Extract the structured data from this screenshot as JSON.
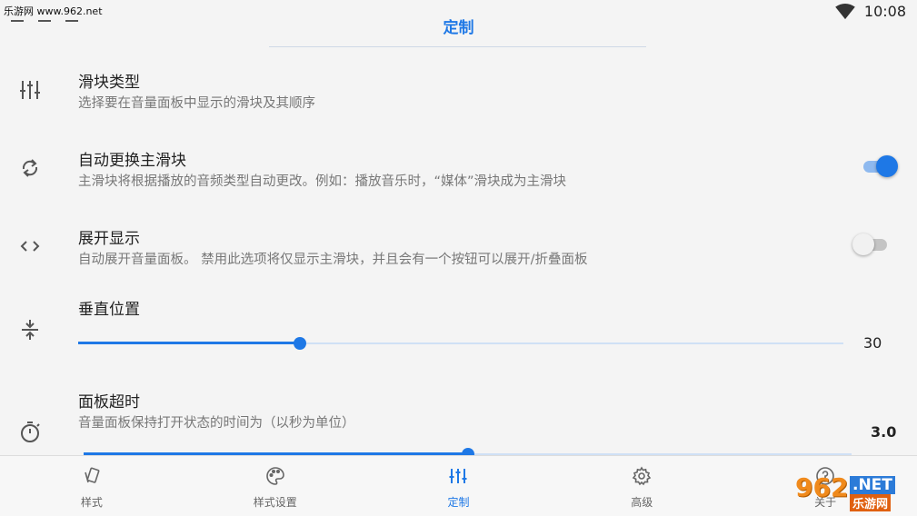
{
  "watermark": "乐游网 www.962.net",
  "status": {
    "time": "10:08",
    "wifi_icon": "wifi-icon"
  },
  "header": {
    "title": "定制"
  },
  "settings": [
    {
      "icon": "sliders-icon",
      "label": "滑块类型",
      "sub": "选择要在音量面板中显示的滑块及其顺序"
    },
    {
      "icon": "sync-icon",
      "label": "自动更换主滑块",
      "sub": "主滑块将根据播放的音频类型自动更改。例如：播放音乐时，“媒体”滑块成为主滑块",
      "toggle": true
    },
    {
      "icon": "code-icon",
      "label": "展开显示",
      "sub": "自动展开音量面板。 禁用此选项将仅显示主滑块，并且会有一个按钮可以展开/折叠面板",
      "toggle": false
    },
    {
      "icon": "vertical-align-center-icon",
      "label": "垂直位置",
      "value": "30",
      "fraction": 0.29
    },
    {
      "icon": "timer-icon",
      "label": "面板超时",
      "sub": "音量面板保持打开状态的时间为（以秒为单位）",
      "value": "3.0",
      "fraction": 0.5
    }
  ],
  "bottom_nav": [
    {
      "icon": "style-icon",
      "label": "样式"
    },
    {
      "icon": "palette-icon",
      "label": "样式设置"
    },
    {
      "icon": "tune-icon",
      "label": "定制",
      "active": true
    },
    {
      "icon": "gear-icon",
      "label": "高级"
    },
    {
      "icon": "help-icon",
      "label": "关于"
    }
  ],
  "logo": {
    "digits": "962",
    "net": ".NET",
    "site": "乐游网"
  },
  "colors": {
    "accent": "#1e78e6",
    "background": "#f4f4f4"
  }
}
